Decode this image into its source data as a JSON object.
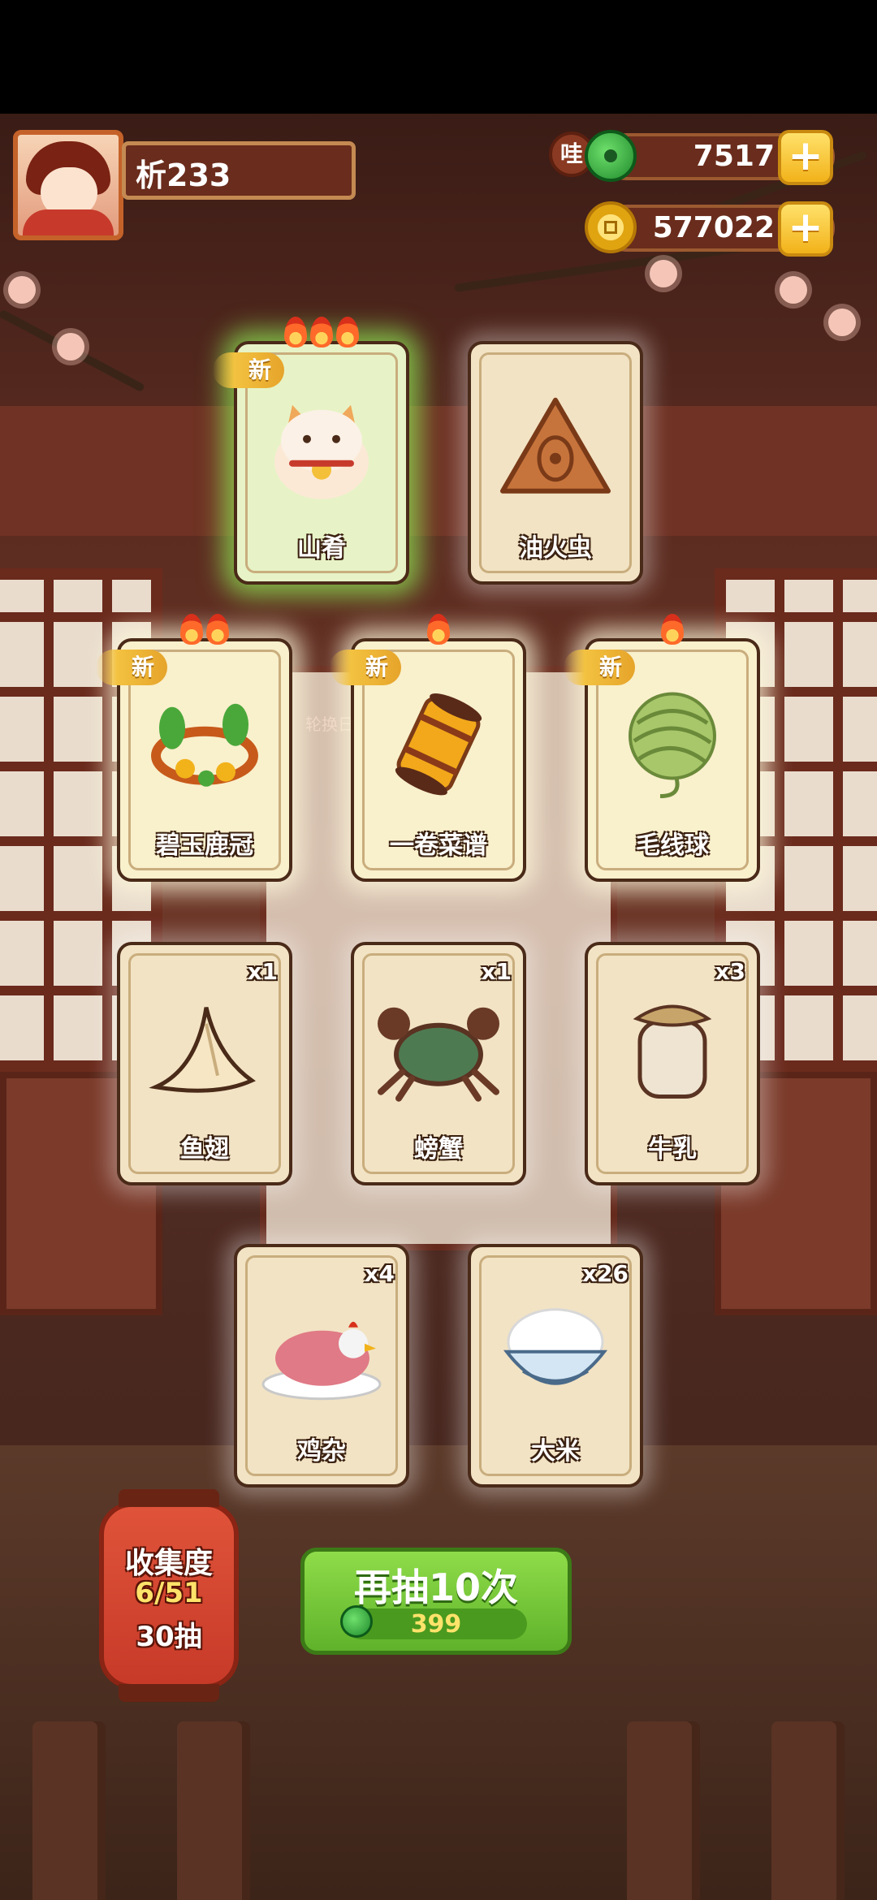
{
  "player": {
    "name": "析233"
  },
  "currencies": {
    "wa_label": "哇",
    "jade_amount": "7517",
    "gold_amount": "577022",
    "plus_symbol": "+"
  },
  "hidden_text": {
    "calendar": "轮换日历"
  },
  "cards": [
    {
      "label": "山肴",
      "is_new": true,
      "new_label": "新",
      "flames": 3,
      "count": "",
      "art": "cat-icon"
    },
    {
      "label": "油火虫",
      "is_new": false,
      "new_label": "",
      "flames": 0,
      "count": "",
      "art": "firefly-icon"
    },
    {
      "label": "碧玉鹿冠",
      "is_new": true,
      "new_label": "新",
      "flames": 2,
      "count": "",
      "art": "jade-antler-icon"
    },
    {
      "label": "一卷菜谱",
      "is_new": true,
      "new_label": "新",
      "flames": 1,
      "count": "",
      "art": "recipe-scroll-icon"
    },
    {
      "label": "毛线球",
      "is_new": true,
      "new_label": "新",
      "flames": 1,
      "count": "",
      "art": "yarn-ball-icon"
    },
    {
      "label": "鱼翅",
      "is_new": false,
      "new_label": "",
      "flames": 0,
      "count": "x1",
      "art": "shark-fin-icon"
    },
    {
      "label": "螃蟹",
      "is_new": false,
      "new_label": "",
      "flames": 0,
      "count": "x1",
      "art": "crab-icon"
    },
    {
      "label": "牛乳",
      "is_new": false,
      "new_label": "",
      "flames": 0,
      "count": "x3",
      "art": "milk-jar-icon"
    },
    {
      "label": "鸡杂",
      "is_new": false,
      "new_label": "",
      "flames": 0,
      "count": "x4",
      "art": "chicken-icon"
    },
    {
      "label": "大米",
      "is_new": false,
      "new_label": "",
      "flames": 0,
      "count": "x26",
      "art": "rice-bowl-icon"
    }
  ],
  "collection": {
    "title": "收集度",
    "progress": "6/51",
    "draws": "30抽"
  },
  "draw_button": {
    "label": "再抽10次",
    "cost": "399"
  }
}
